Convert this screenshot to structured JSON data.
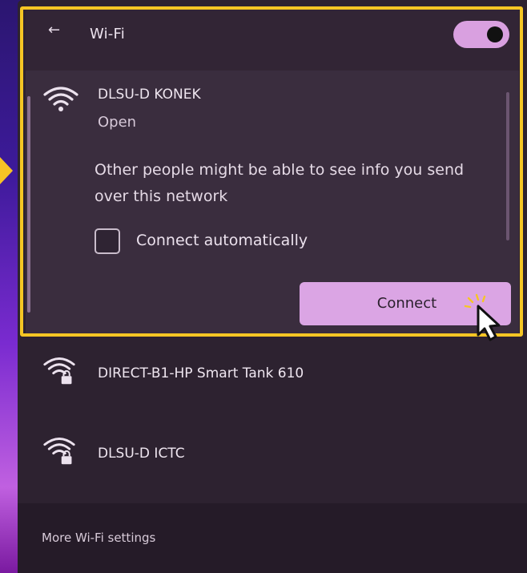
{
  "header": {
    "back_icon": "←",
    "title": "Wi-Fi",
    "toggle_state": "on"
  },
  "selected_network": {
    "name": "DLSU-D KONEK",
    "status": "Open",
    "warning": "Other people might be able to see info you send over this network",
    "auto_connect_label": "Connect automatically",
    "auto_connect_checked": false,
    "connect_label": "Connect"
  },
  "networks": [
    {
      "name": "DIRECT-B1-HP Smart Tank 610",
      "secured": true
    },
    {
      "name": "DLSU-D ICTC",
      "secured": true
    }
  ],
  "footer": {
    "settings_link": "More Wi-Fi settings"
  },
  "colors": {
    "accent": "#dba5e4",
    "highlight": "#f5c624",
    "panel": "#2d2230"
  }
}
